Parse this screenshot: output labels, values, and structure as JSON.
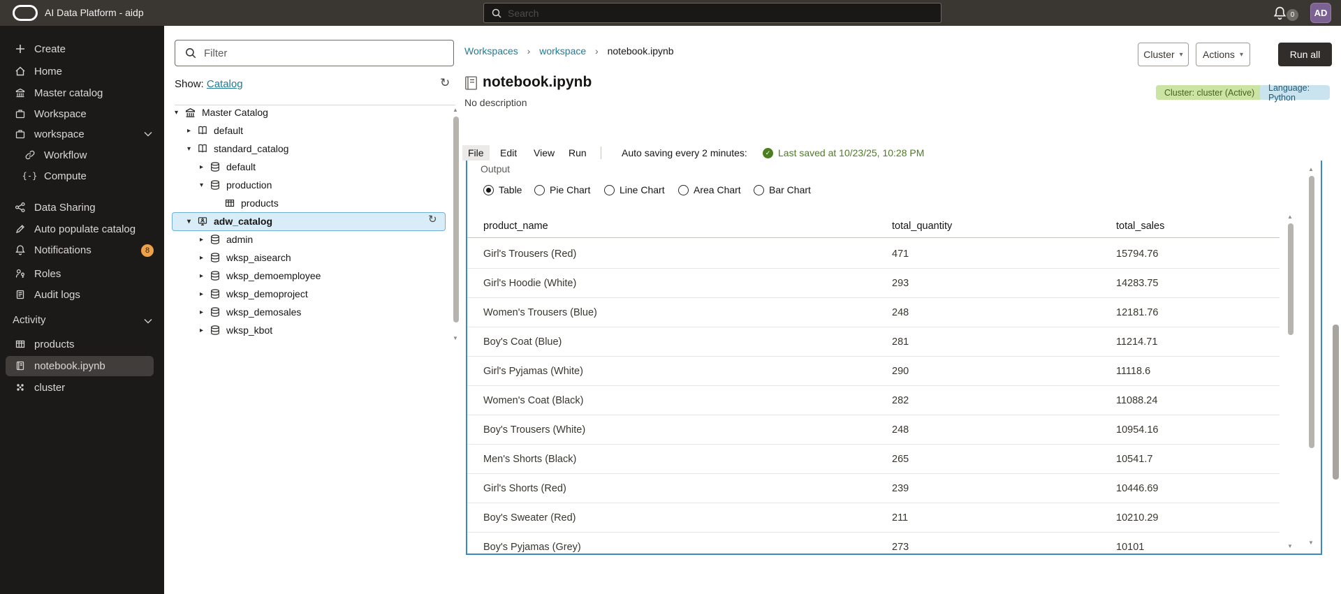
{
  "topbar": {
    "title": "AI Data Platform - aidp",
    "search_placeholder": "Search",
    "notification_count": "0",
    "avatar_initials": "AD"
  },
  "sidebar": {
    "items": [
      {
        "label": "Create"
      },
      {
        "label": "Home"
      },
      {
        "label": "Master catalog"
      },
      {
        "label": "Workspace"
      },
      {
        "label": "workspace"
      },
      {
        "label": "Workflow"
      },
      {
        "label": "Compute"
      },
      {
        "label": "Data Sharing"
      },
      {
        "label": "Auto populate catalog"
      },
      {
        "label": "Notifications",
        "badge": "8"
      },
      {
        "label": "Roles"
      },
      {
        "label": "Audit logs"
      }
    ],
    "activity": {
      "label": "Activity",
      "items": [
        {
          "label": "products"
        },
        {
          "label": "notebook.ipynb",
          "selected": true
        },
        {
          "label": "cluster"
        }
      ]
    }
  },
  "catalog_panel": {
    "filter_placeholder": "Filter",
    "show_label": "Show:",
    "show_link": "Catalog",
    "tree": [
      {
        "label": "Master Catalog"
      },
      {
        "label": "default"
      },
      {
        "label": "standard_catalog"
      },
      {
        "label": "default"
      },
      {
        "label": "production"
      },
      {
        "label": "products"
      },
      {
        "label": "adw_catalog",
        "selected": true
      },
      {
        "label": "admin"
      },
      {
        "label": "wksp_aisearch"
      },
      {
        "label": "wksp_demoemployee"
      },
      {
        "label": "wksp_demoproject"
      },
      {
        "label": "wksp_demosales"
      },
      {
        "label": "wksp_kbot"
      }
    ]
  },
  "main": {
    "breadcrumb": {
      "items": [
        "Workspaces",
        "workspace",
        "notebook.ipynb"
      ]
    },
    "toolbar": {
      "cluster_label": "Cluster",
      "actions_label": "Actions",
      "run_all_label": "Run all"
    },
    "title": "notebook.ipynb",
    "description": "No description",
    "badges": {
      "cluster": "Cluster: cluster (Active)",
      "language": "Language: Python"
    },
    "menu": {
      "items": [
        "File",
        "Edit",
        "View",
        "Run"
      ]
    },
    "autosave": {
      "label": "Auto saving every 2 minutes:",
      "saved": "Last saved at 10/23/25, 10:28 PM"
    },
    "output": {
      "label": "Output",
      "selected_view": "Table",
      "views": [
        {
          "label": "Table"
        },
        {
          "label": "Pie Chart"
        },
        {
          "label": "Line Chart"
        },
        {
          "label": "Area Chart"
        },
        {
          "label": "Bar Chart"
        }
      ],
      "table": {
        "columns": [
          "product_name",
          "total_quantity",
          "total_sales"
        ],
        "rows": [
          [
            "Girl's Trousers (Red)",
            "471",
            "15794.76"
          ],
          [
            "Girl's Hoodie (White)",
            "293",
            "14283.75"
          ],
          [
            "Women's Trousers (Blue)",
            "248",
            "12181.76"
          ],
          [
            "Boy's Coat (Blue)",
            "281",
            "11214.71"
          ],
          [
            "Girl's Pyjamas (White)",
            "290",
            "11118.6"
          ],
          [
            "Women's Coat (Black)",
            "282",
            "11088.24"
          ],
          [
            "Boy's Trousers (White)",
            "248",
            "10954.16"
          ],
          [
            "Men's Shorts (Black)",
            "265",
            "10541.7"
          ],
          [
            "Girl's Shorts (Red)",
            "239",
            "10446.69"
          ],
          [
            "Boy's Sweater (Red)",
            "211",
            "10210.29"
          ],
          [
            "Boy's Pyjamas (Grey)",
            "273",
            "10101"
          ]
        ]
      }
    },
    "colors": {
      "accent_blue": "#3b87c8",
      "link_teal": "#227b94",
      "badge_green_bg": "#cbe3a3",
      "badge_blue_bg": "#c9e4ef",
      "saved_green": "#4c7d20",
      "notification_orange": "#eda24a"
    }
  }
}
